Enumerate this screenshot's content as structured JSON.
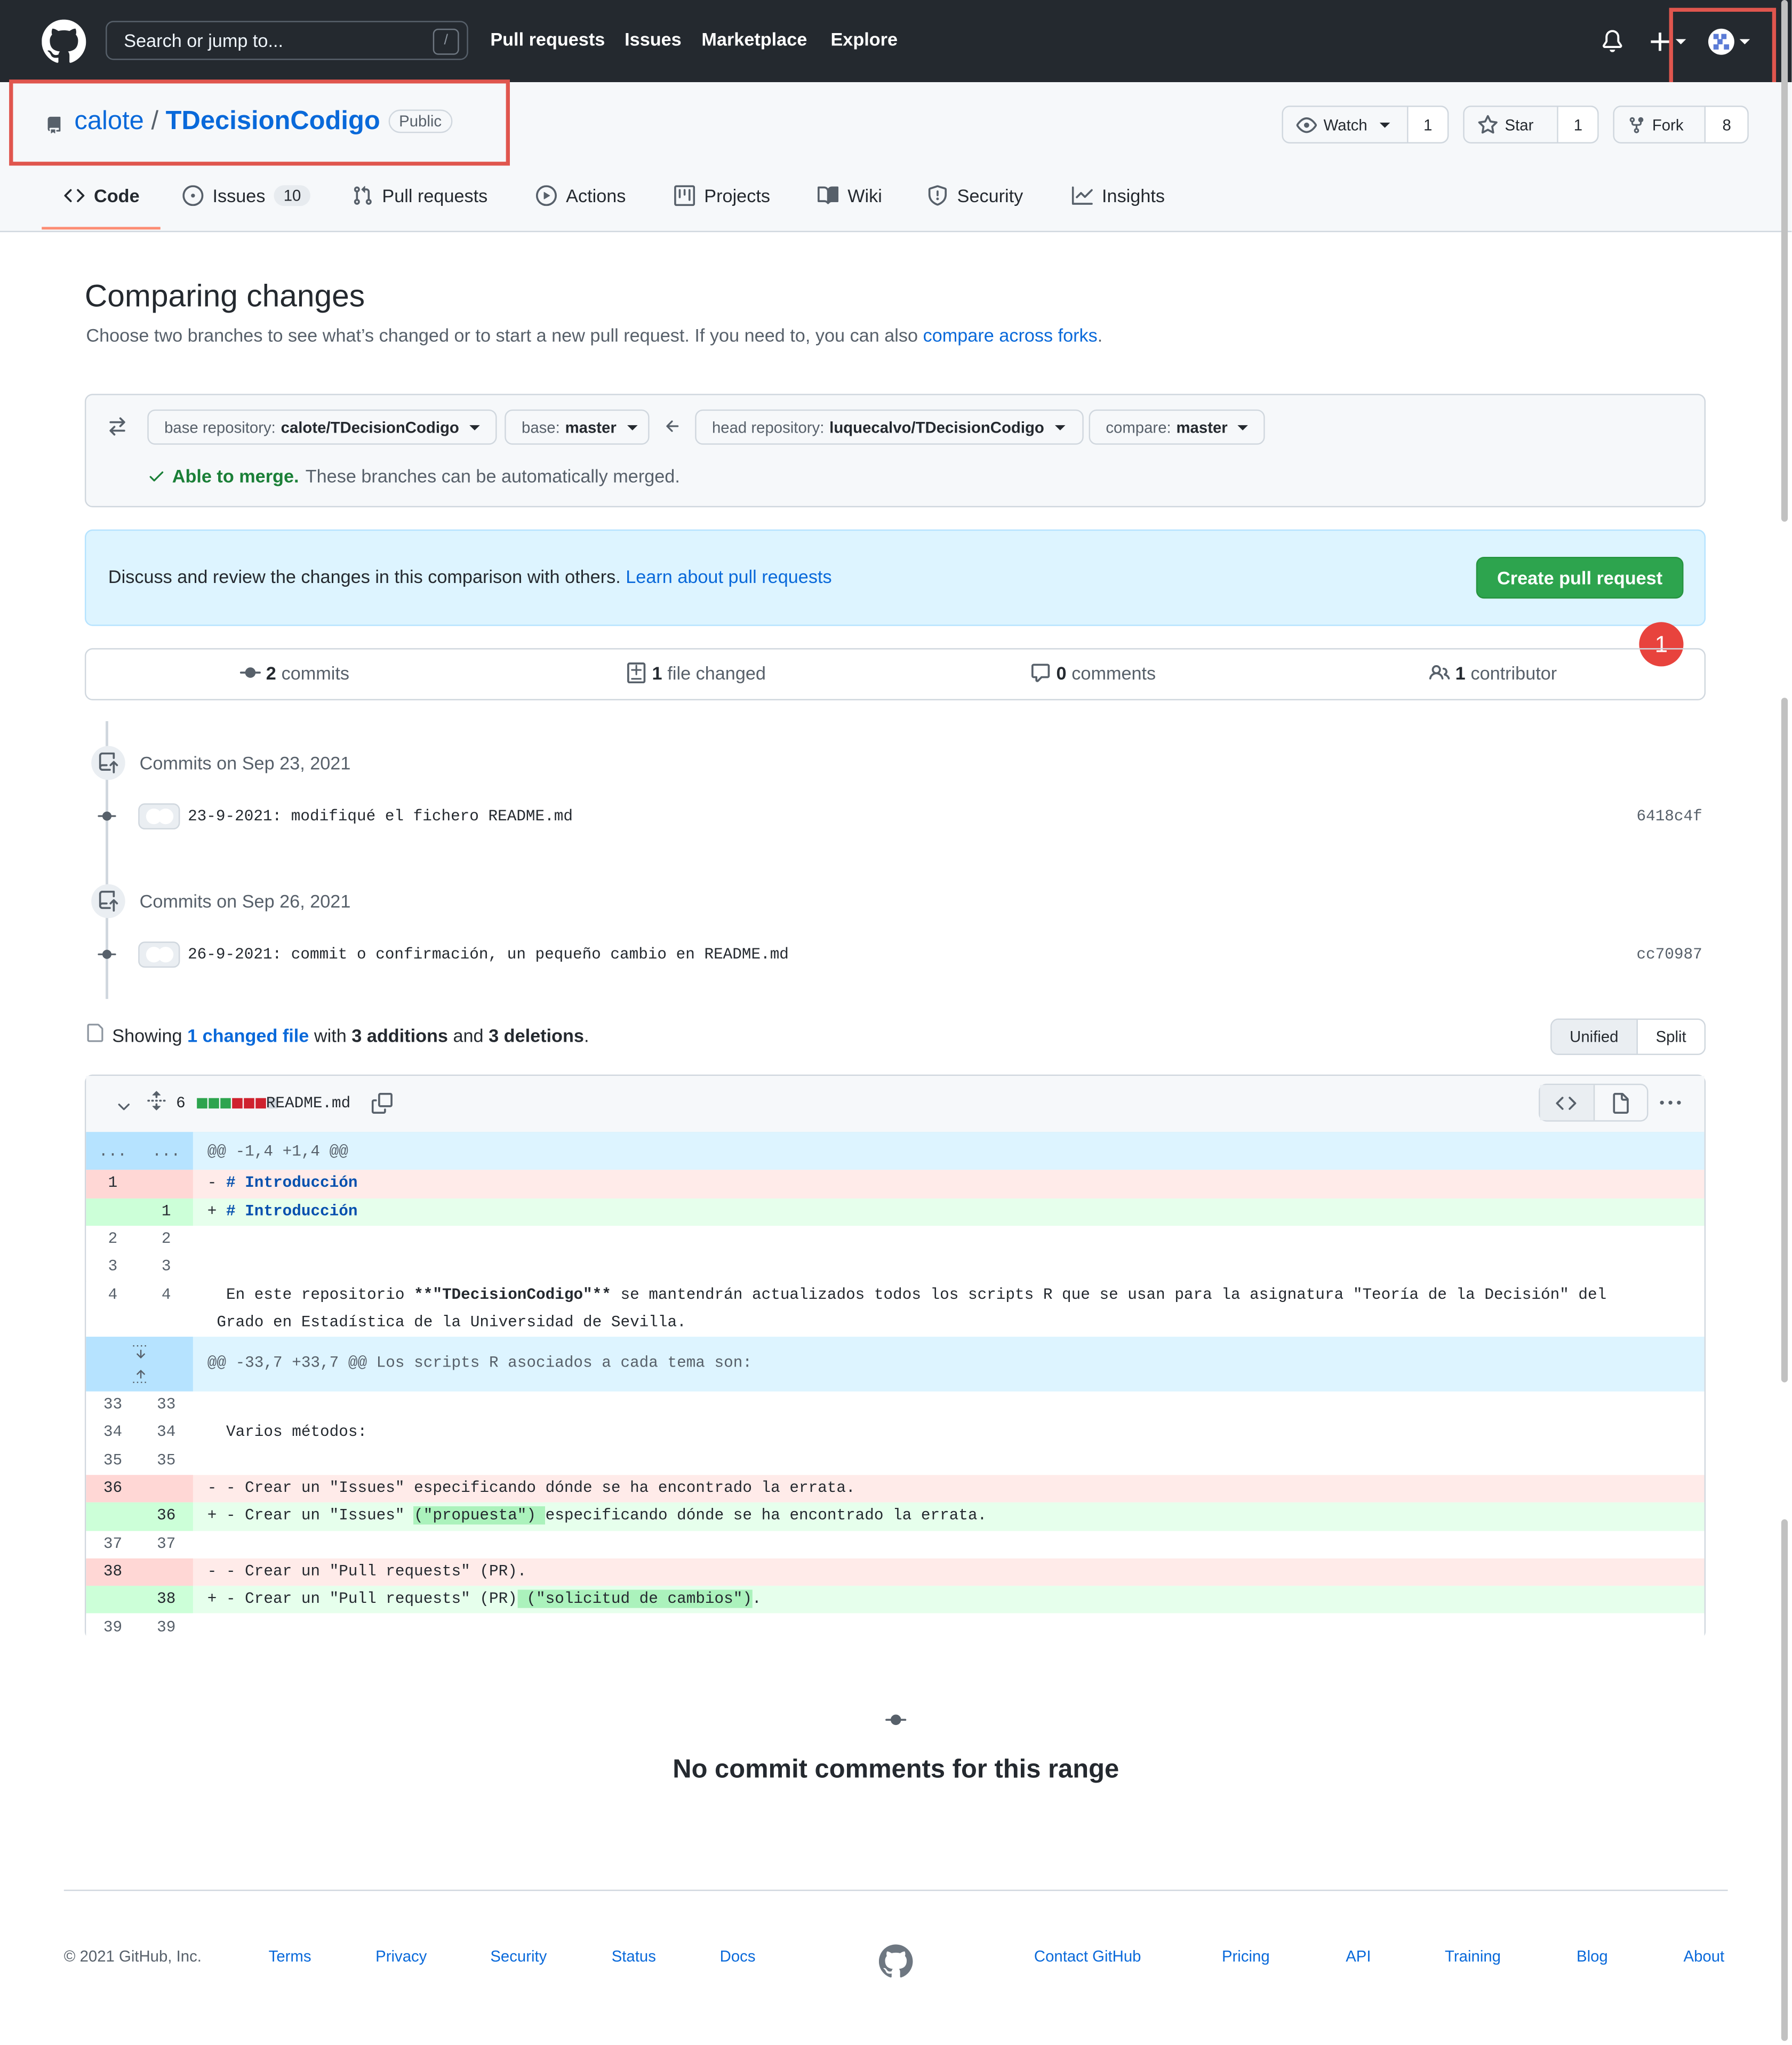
{
  "header": {
    "search_placeholder": "Search or jump to...",
    "search_shortcut": "/",
    "nav": [
      "Pull requests",
      "Issues",
      "Marketplace",
      "Explore"
    ]
  },
  "repo": {
    "owner": "calote",
    "separator": "/",
    "name": "TDecisionCodigo",
    "visibility": "Public",
    "watch": {
      "label": "Watch",
      "count": "1"
    },
    "star": {
      "label": "Star",
      "count": "1"
    },
    "fork": {
      "label": "Fork",
      "count": "8"
    }
  },
  "tabs": [
    {
      "label": "Code",
      "icon": "code-icon",
      "selected": true
    },
    {
      "label": "Issues",
      "icon": "issue-icon",
      "counter": "10"
    },
    {
      "label": "Pull requests",
      "icon": "pull-request-icon"
    },
    {
      "label": "Actions",
      "icon": "play-icon"
    },
    {
      "label": "Projects",
      "icon": "project-icon"
    },
    {
      "label": "Wiki",
      "icon": "book-icon"
    },
    {
      "label": "Security",
      "icon": "shield-icon"
    },
    {
      "label": "Insights",
      "icon": "graph-icon"
    }
  ],
  "compare": {
    "title": "Comparing changes",
    "desc": "Choose two branches to see what’s changed or to start a new pull request. If you need to, you can also",
    "desc_link": "compare across forks",
    "desc_end": ".",
    "base_repo_label": "base repository:",
    "base_repo_value": "calote/TDecisionCodigo",
    "base_label": "base:",
    "base_value": "master",
    "head_repo_label": "head repository:",
    "head_repo_value": "luquecalvo/TDecisionCodigo",
    "compare_label": "compare:",
    "compare_value": "master",
    "merge_ok": "Able to merge.",
    "merge_text": "These branches can be automatically merged."
  },
  "flash": {
    "text": "Discuss and review the changes in this comparison with others.",
    "link": "Learn about pull requests",
    "button": "Create pull request",
    "marker": "1"
  },
  "summary": {
    "commits_count": "2",
    "commits_label": "commits",
    "files_count": "1",
    "files_label": "file changed",
    "comments_count": "0",
    "comments_label": "comments",
    "contrib_count": "1",
    "contrib_label": "contributor"
  },
  "commit_groups": [
    {
      "title": "Commits on Sep 23, 2021",
      "message": "23-9-2021: modifiqué el fichero README.md",
      "sha": "6418c4f"
    },
    {
      "title": "Commits on Sep 26, 2021",
      "message": "26-9-2021: commit o confirmación, un pequeño cambio en README.md",
      "sha": "cc70987"
    }
  ],
  "showing": {
    "prefix": "Showing",
    "link": "1 changed file",
    "with": "with",
    "additions": "3 additions",
    "and": "and",
    "deletions": "3 deletions",
    "end": "."
  },
  "view_toggle": {
    "unified": "Unified",
    "split": "Split"
  },
  "file": {
    "changes": "6",
    "name": "README.md",
    "diffstat_colors": [
      "#2da44e",
      "#2da44e",
      "#2da44e",
      "#cf222e",
      "#cf222e",
      "#cf222e",
      "#d0d7de"
    ]
  },
  "diff_lines": [
    {
      "kind": "hunk",
      "old": "...",
      "new": "...",
      "code": "@@ -1,4 +1,4 @@"
    },
    {
      "kind": "del",
      "old": "1",
      "new": "",
      "code": "- # Introducción"
    },
    {
      "kind": "add",
      "old": "",
      "new": "1",
      "code": "+ # Introducción"
    },
    {
      "kind": "ctx",
      "old": "2",
      "new": "2",
      "code": ""
    },
    {
      "kind": "ctx",
      "old": "3",
      "new": "3",
      "code": ""
    },
    {
      "kind": "ctx",
      "old": "4",
      "new": "4",
      "code": "  En este repositorio **\"TDecisionCodigo\"** se mantendrán actualizados todos los scripts R que se usan para la asignatura \"Teoría de la Decisión\" del",
      "code2": " Grado en Estadística de la Universidad de Sevilla."
    },
    {
      "kind": "hunk2",
      "old": "",
      "new": "",
      "code": "@@ -33,7 +33,7 @@ Los scripts R asociados a cada tema son:"
    },
    {
      "kind": "ctx",
      "old": "33",
      "new": "33",
      "code": ""
    },
    {
      "kind": "ctx",
      "old": "34",
      "new": "34",
      "code": "  Varios métodos:"
    },
    {
      "kind": "ctx",
      "old": "35",
      "new": "35",
      "code": ""
    },
    {
      "kind": "del",
      "old": "36",
      "new": "",
      "code": "- - Crear un \"Issues\" especificando dónde se ha encontrado la errata."
    },
    {
      "kind": "add",
      "old": "",
      "new": "36",
      "code": "+ - Crear un \"Issues\" (\"propuesta\") especificando dónde se ha encontrado la errata."
    },
    {
      "kind": "ctx",
      "old": "37",
      "new": "37",
      "code": ""
    },
    {
      "kind": "del",
      "old": "38",
      "new": "",
      "code": "- - Crear un \"Pull requests\" (PR)."
    },
    {
      "kind": "add",
      "old": "",
      "new": "38",
      "code": "+ - Crear un \"Pull requests\" (PR) (\"solicitud de cambios\")."
    },
    {
      "kind": "ctx",
      "old": "39",
      "new": "39",
      "code": ""
    }
  ],
  "empty": {
    "text": "No commit comments for this range"
  },
  "footer": {
    "copyright": "© 2021 GitHub, Inc.",
    "left_links": [
      "Terms",
      "Privacy",
      "Security",
      "Status",
      "Docs"
    ],
    "right_links": [
      "Contact GitHub",
      "Pricing",
      "API",
      "Training",
      "Blog",
      "About"
    ]
  }
}
